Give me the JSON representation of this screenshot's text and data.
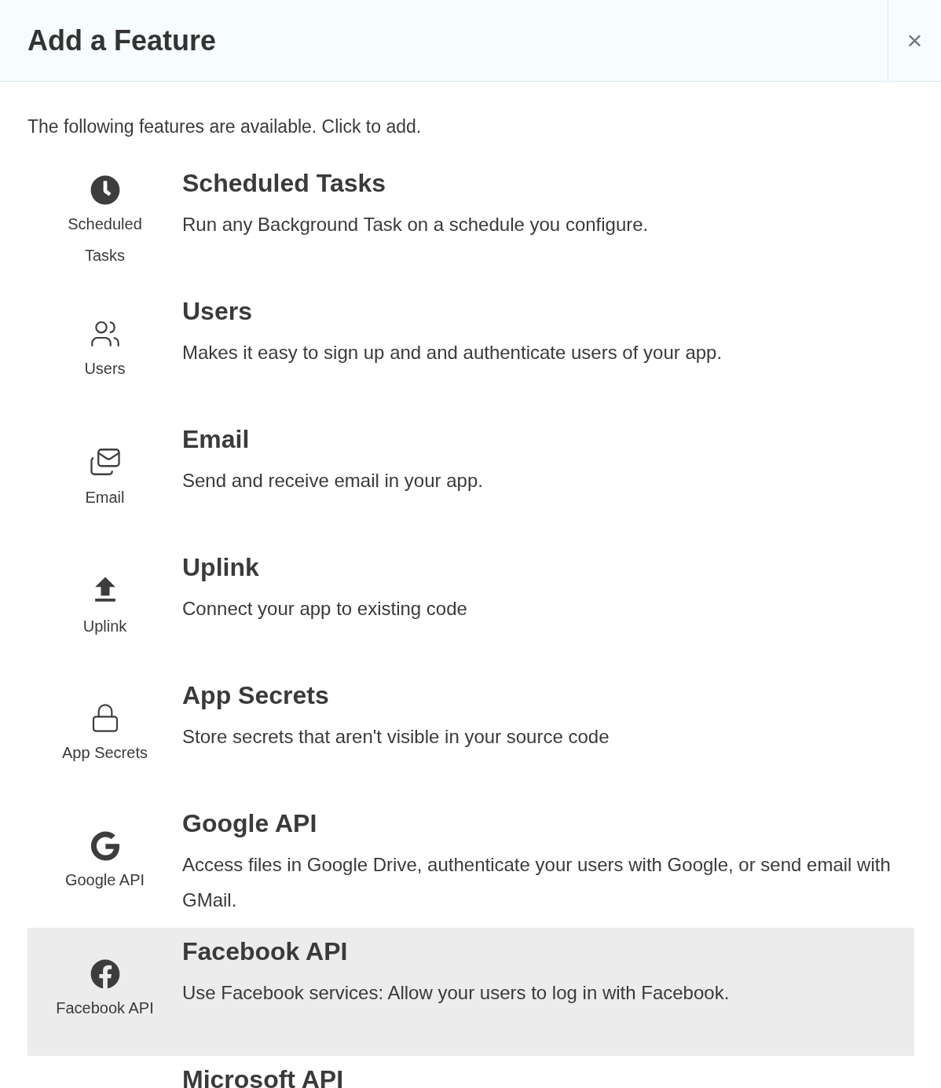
{
  "dialog": {
    "title": "Add a Feature",
    "close_label": "×"
  },
  "intro": "The following features are available. Click to add.",
  "features": [
    {
      "kind": "clock",
      "label": "Scheduled Tasks",
      "title": "Scheduled Tasks",
      "description": "Run any Background Task on a schedule you configure.",
      "selected": false
    },
    {
      "kind": "users",
      "label": "Users",
      "title": "Users",
      "description": "Makes it easy to sign up and and authenticate users of your app.",
      "selected": false
    },
    {
      "kind": "email",
      "label": "Email",
      "title": "Email",
      "description": "Send and receive email in your app.",
      "selected": false
    },
    {
      "kind": "upload",
      "label": "Uplink",
      "title": "Uplink",
      "description": "Connect your app to existing code",
      "selected": false
    },
    {
      "kind": "lock",
      "label": "App Secrets",
      "title": "App Secrets",
      "description": "Store secrets that aren't visible in your source code",
      "selected": false
    },
    {
      "kind": "google",
      "label": "Google API",
      "title": "Google API",
      "description": "Access files in Google Drive, authenticate your users with Google, or send email with GMail.",
      "selected": false
    },
    {
      "kind": "facebook",
      "label": "Facebook API",
      "title": "Facebook API",
      "description": "Use Facebook services: Allow your users to log in with Facebook.",
      "selected": true
    },
    {
      "kind": "none",
      "title": "Microsoft API",
      "selected": false
    }
  ]
}
